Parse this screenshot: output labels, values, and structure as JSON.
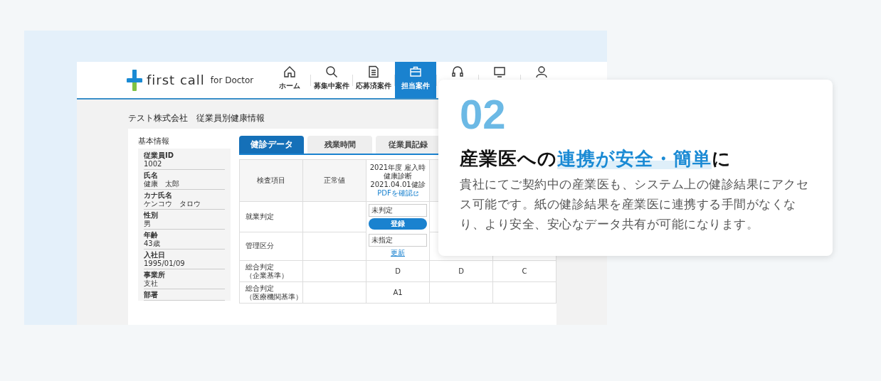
{
  "app": {
    "logo": {
      "name": "first call",
      "suffix": "for Doctor"
    },
    "nav": [
      {
        "label": "ホーム",
        "selected": false
      },
      {
        "label": "募集中案件",
        "selected": false
      },
      {
        "label": "応募済案件",
        "selected": false
      },
      {
        "label": "担当案件",
        "selected": true
      },
      {
        "selected": false
      },
      {
        "selected": false
      },
      {
        "selected": false
      }
    ],
    "page_title": "テスト株式会社　従業員別健康情報",
    "basic_info": {
      "title": "基本情報",
      "fields": [
        {
          "label": "従業員ID",
          "value": "1002"
        },
        {
          "label": "氏名",
          "value": "健康　太郎"
        },
        {
          "label": "カナ氏名",
          "value": "ケンコウ　タロウ"
        },
        {
          "label": "性別",
          "value": "男"
        },
        {
          "label": "年齢",
          "value": "43歳"
        },
        {
          "label": "入社日",
          "value": "1995/01/09"
        },
        {
          "label": "事業所",
          "value": "支社"
        },
        {
          "label": "部署"
        }
      ]
    },
    "tabs": [
      {
        "label": "健診データ",
        "selected": true
      },
      {
        "label": "残業時間",
        "selected": false
      },
      {
        "label": "従業員記録",
        "selected": false
      }
    ],
    "table": {
      "columns": [
        "検査項目",
        "正常値",
        {
          "title": "2021年度 雇入時健康診断",
          "date": "2021.04.01健診",
          "link": "PDFを確認"
        }
      ],
      "rows": [
        {
          "kind": "selectbutton",
          "label": [
            "就業判定"
          ],
          "select": "未判定",
          "action": "登録"
        },
        {
          "kind": "selectlink",
          "label": [
            "管理区分"
          ],
          "select": "未指定",
          "action": "更新"
        },
        {
          "kind": "values",
          "label": [
            "総合判定",
            "（企業基準）"
          ],
          "values": [
            "D",
            "D",
            "C"
          ]
        },
        {
          "kind": "values",
          "label": [
            "総合判定",
            "（医療機関基準）"
          ],
          "values": [
            "A1"
          ]
        }
      ]
    }
  },
  "card": {
    "number": "02",
    "heading": [
      {
        "text": "産業医への",
        "highlight": false
      },
      {
        "text": "連携が安全・簡単",
        "highlight": true
      },
      {
        "text": "に",
        "highlight": false
      }
    ],
    "body": "貴社にてご契約中の産業医も、システム上の健診結果にアクセス可能です。紙の健診結果を産業医に連携する手間がなくなり、より安全、安心なデータ共有が可能になります。"
  }
}
